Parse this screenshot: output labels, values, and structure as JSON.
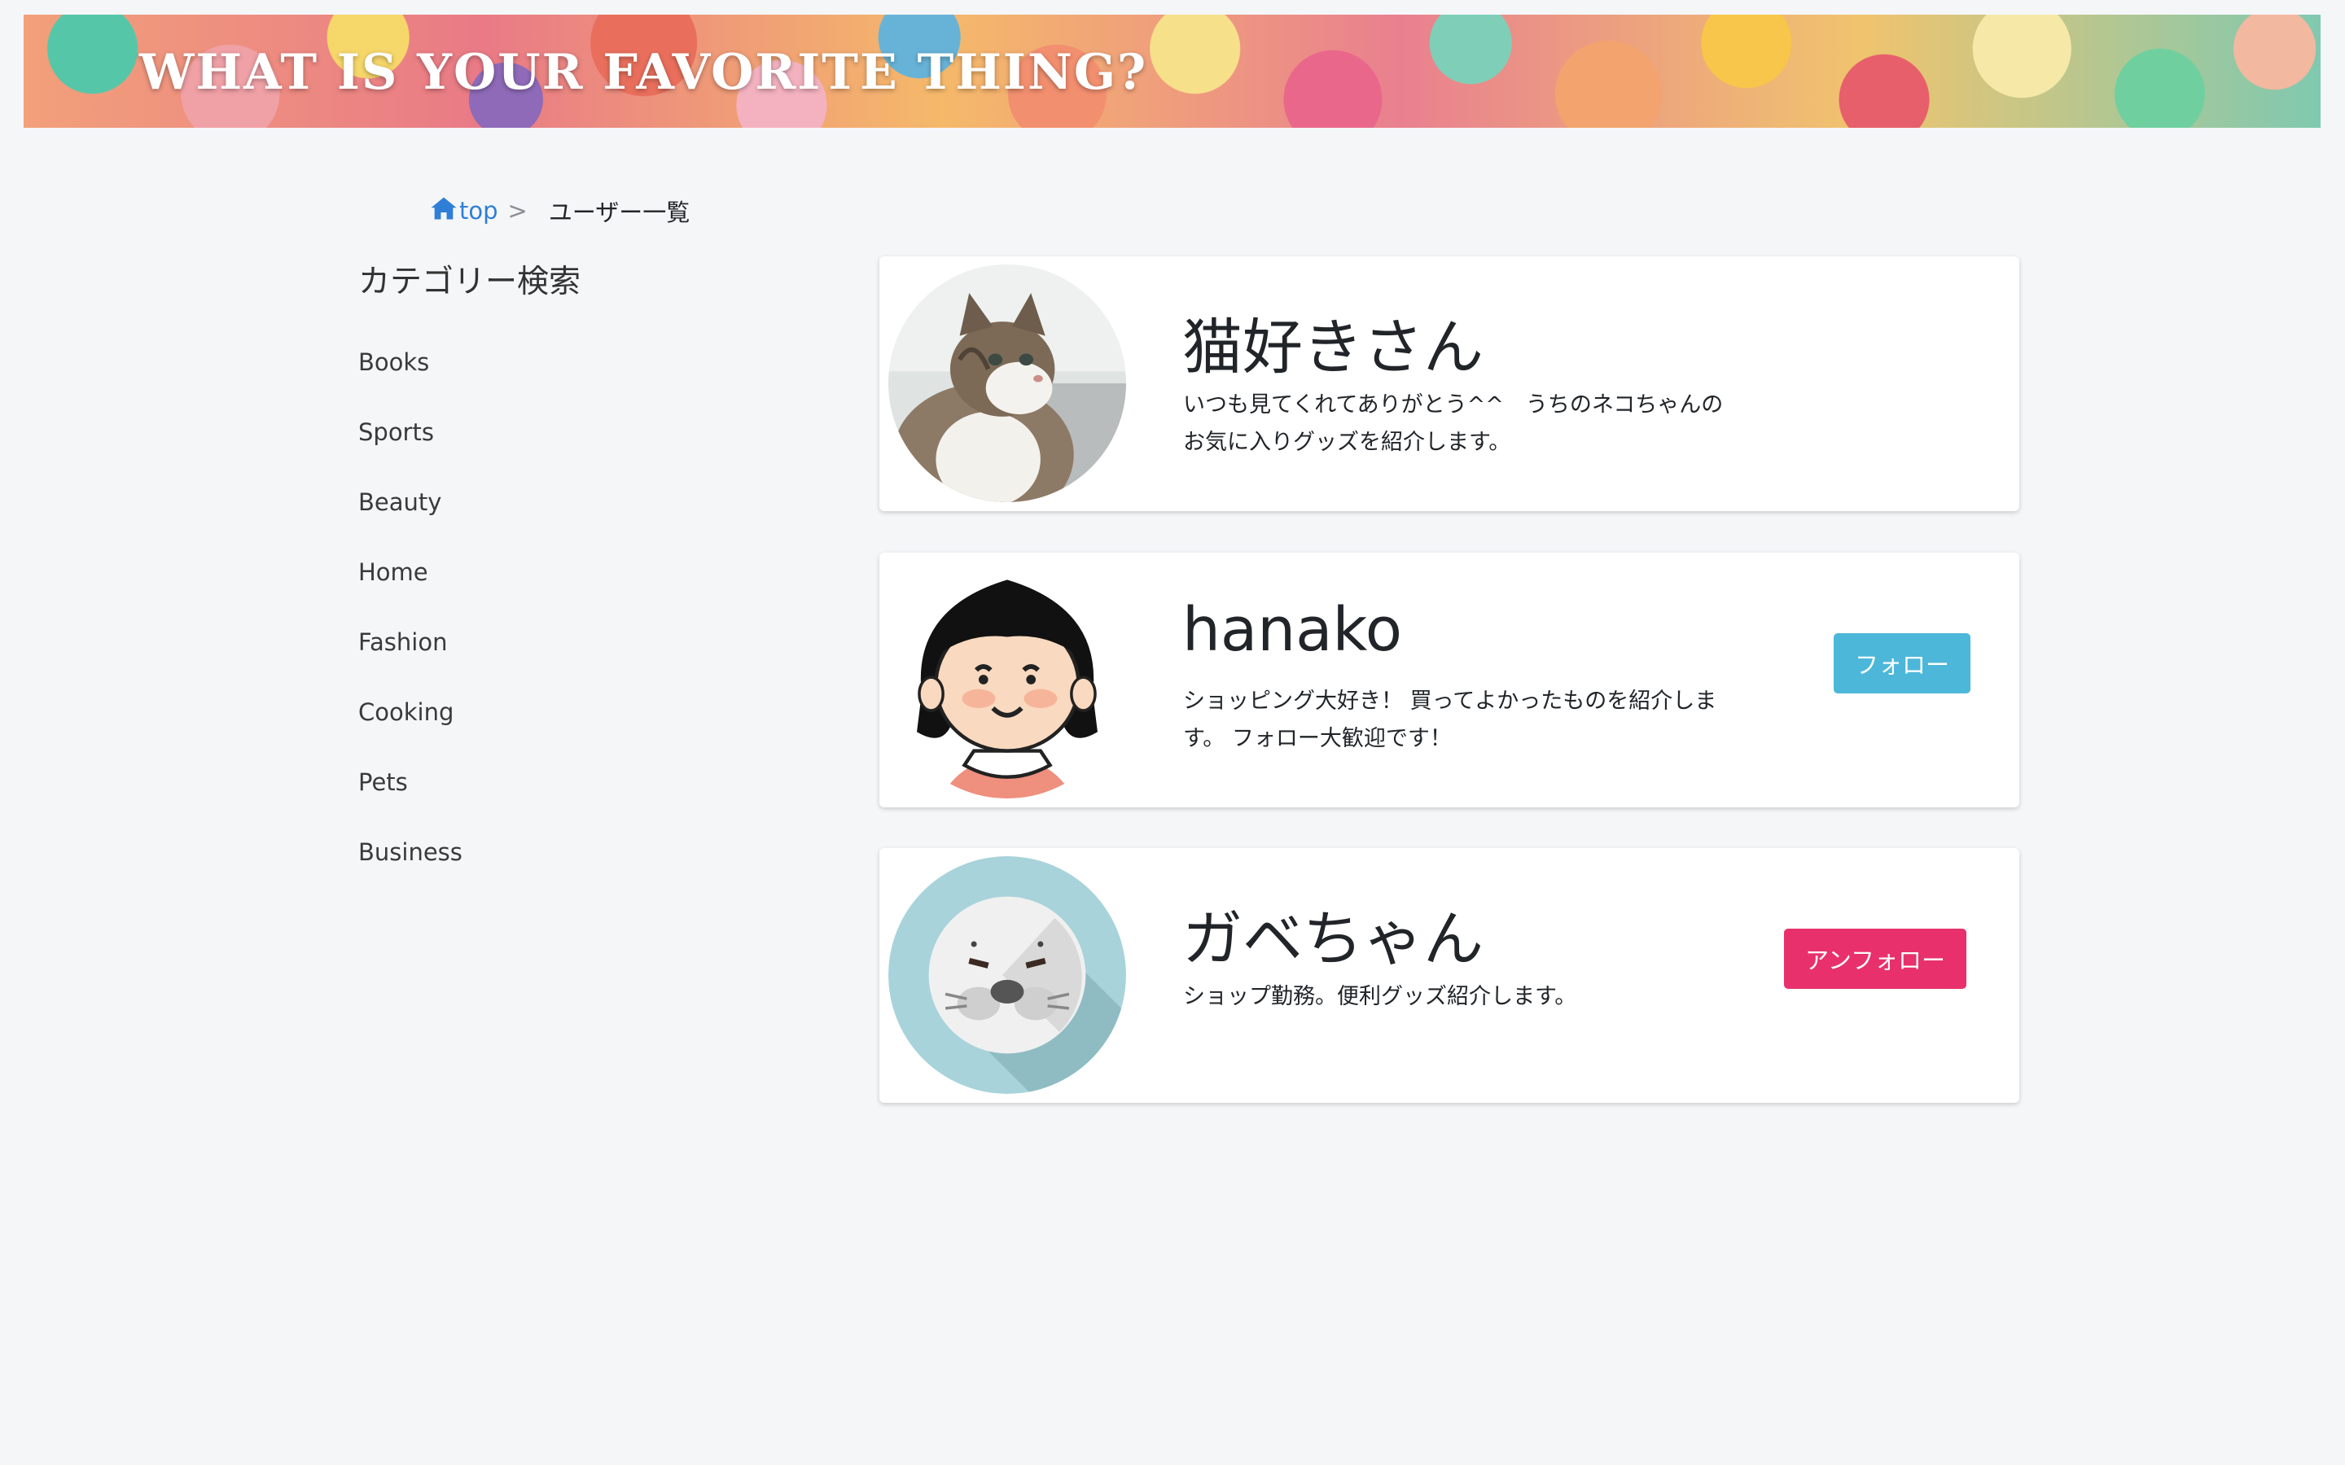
{
  "banner": {
    "title": "WHAT IS YOUR FAVORITE THING?"
  },
  "breadcrumb": {
    "home_label": "top",
    "separator": ">",
    "current": "ユーザー一覧"
  },
  "sidebar": {
    "title": "カテゴリー検索",
    "items": [
      {
        "label": "Books"
      },
      {
        "label": "Sports"
      },
      {
        "label": "Beauty"
      },
      {
        "label": "Home"
      },
      {
        "label": "Fashion"
      },
      {
        "label": "Cooking"
      },
      {
        "label": "Pets"
      },
      {
        "label": "Business"
      }
    ]
  },
  "users": [
    {
      "name": "猫好きさん",
      "bio": "いつも見てくれてありがとう^^　うちのネコちゃんのお気に入りグッズを紹介します。",
      "avatar_icon": "cat-photo-avatar",
      "button": null
    },
    {
      "name": "hanako",
      "bio": "ショッピング大好き！ 買ってよかったものを紹介します。 フォロー大歓迎です！",
      "avatar_icon": "girl-illustration-avatar",
      "button": {
        "label": "フォロー",
        "kind": "follow",
        "color": "#4db7d9"
      }
    },
    {
      "name": "ガベちゃん",
      "bio": "ショップ勤務。便利グッズ紹介します。",
      "avatar_icon": "seal-illustration-avatar",
      "button": {
        "label": "アンフォロー",
        "kind": "unfollow",
        "color": "#e8306c"
      }
    }
  ],
  "colors": {
    "background": "#f5f6f8",
    "link": "#2f7fd6",
    "follow": "#4db7d9",
    "unfollow": "#e8306c"
  }
}
